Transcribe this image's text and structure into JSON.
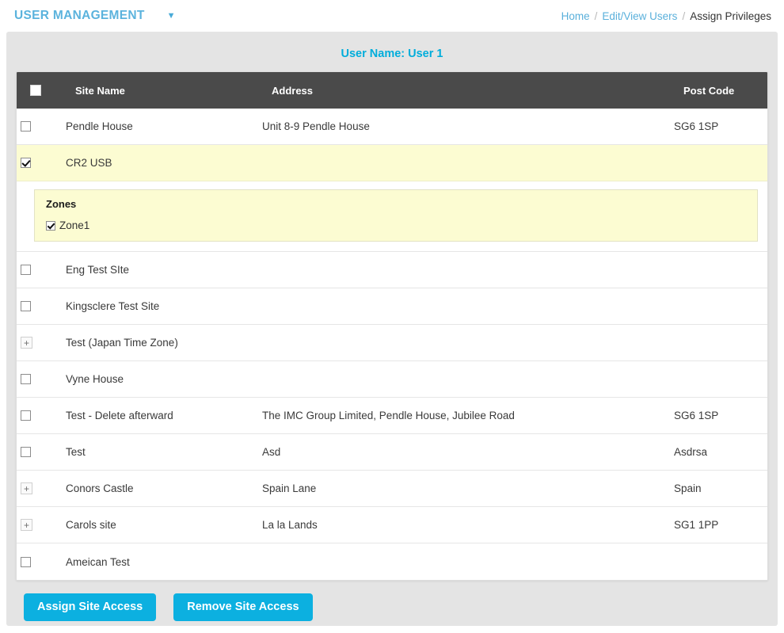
{
  "header": {
    "app_title": "USER MANAGEMENT",
    "caret_icon": "chevron-down-icon",
    "breadcrumb": {
      "home": "Home",
      "sep1": "/",
      "edit_view_users": "Edit/View Users",
      "sep2": "/",
      "current": "Assign Privileges"
    }
  },
  "banner": {
    "user_label": "User Name: User 1"
  },
  "table": {
    "columns": {
      "site_name": "Site Name",
      "address": "Address",
      "post_code": "Post Code"
    },
    "select_all_checked": false,
    "rows": [
      {
        "control": "checkbox",
        "checked": false,
        "site_name": "Pendle House",
        "address": "Unit 8-9 Pendle House",
        "post_code": "SG6 1SP",
        "highlight": false
      },
      {
        "control": "checkbox",
        "checked": true,
        "site_name": "CR2 USB",
        "address": "",
        "post_code": "",
        "highlight": true
      },
      {
        "control": "checkbox",
        "checked": false,
        "site_name": "Eng Test SIte",
        "address": "",
        "post_code": "",
        "highlight": false
      },
      {
        "control": "checkbox",
        "checked": false,
        "site_name": "Kingsclere Test Site",
        "address": "",
        "post_code": "",
        "highlight": false
      },
      {
        "control": "expander",
        "checked": false,
        "site_name": "Test (Japan Time Zone)",
        "address": "",
        "post_code": "",
        "highlight": false
      },
      {
        "control": "checkbox",
        "checked": false,
        "site_name": "Vyne House",
        "address": "",
        "post_code": "",
        "highlight": false
      },
      {
        "control": "checkbox",
        "checked": false,
        "site_name": "Test - Delete afterward",
        "address": "The IMC Group Limited, Pendle House, Jubilee Road",
        "post_code": "SG6 1SP",
        "highlight": false
      },
      {
        "control": "checkbox",
        "checked": false,
        "site_name": "Test",
        "address": "Asd",
        "post_code": "Asdrsa",
        "highlight": false
      },
      {
        "control": "expander",
        "checked": false,
        "site_name": "Conors Castle",
        "address": "Spain Lane",
        "post_code": "Spain",
        "highlight": false
      },
      {
        "control": "expander",
        "checked": false,
        "site_name": "Carols site",
        "address": "La la Lands",
        "post_code": "SG1 1PP",
        "highlight": false
      },
      {
        "control": "checkbox",
        "checked": false,
        "site_name": "Ameican Test",
        "address": "",
        "post_code": "",
        "highlight": false
      }
    ],
    "zones_panel": {
      "title": "Zones",
      "items": [
        {
          "label": "Zone1",
          "checked": true
        }
      ]
    },
    "expander_glyph": "+"
  },
  "footer": {
    "assign_label": "Assign Site Access",
    "remove_label": "Remove Site Access"
  },
  "colors": {
    "accent": "#0cb0e0",
    "title": "#5bb3dd",
    "header_bg": "#4a4a4a",
    "highlight_row": "#fcfcd2",
    "page_bg": "#e4e4e4"
  }
}
